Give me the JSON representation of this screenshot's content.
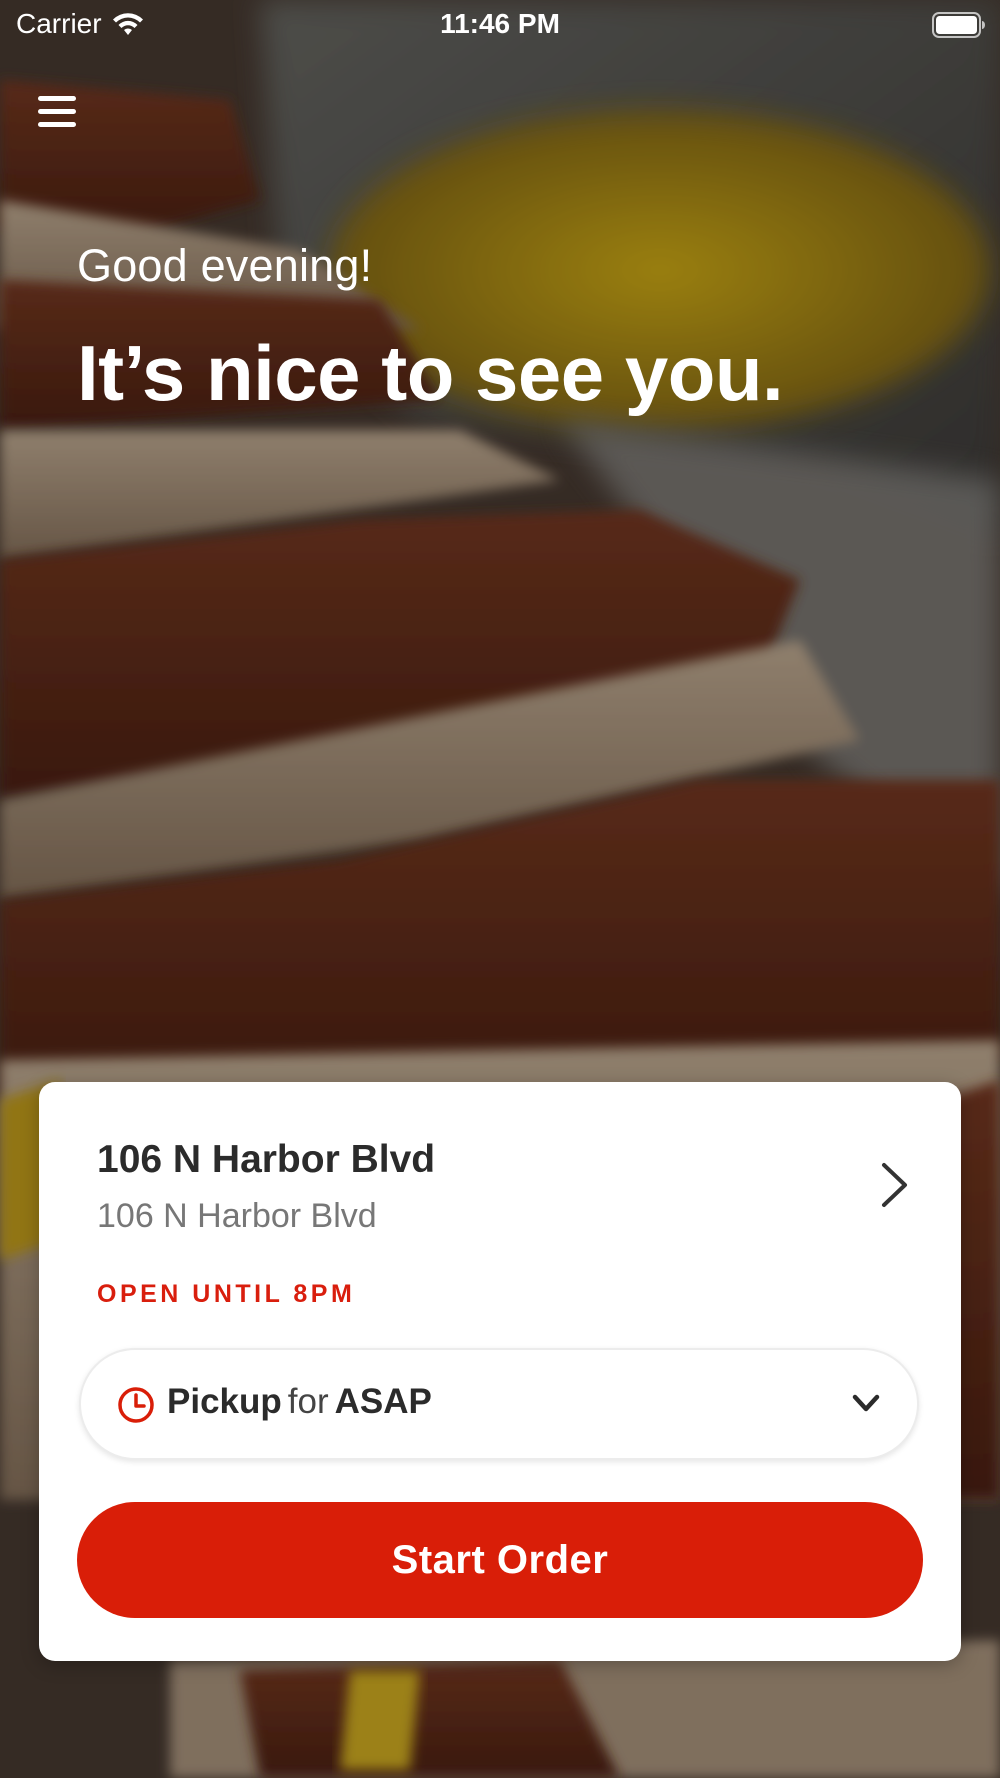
{
  "status_bar": {
    "carrier": "Carrier",
    "time": "11:46 PM",
    "wifi_icon": "wifi-icon",
    "battery_icon": "battery-icon"
  },
  "header": {
    "menu_icon": "hamburger-menu-icon"
  },
  "greeting": {
    "salutation": "Good evening!",
    "headline": "It’s nice to see you."
  },
  "location_card": {
    "name": "106 N Harbor Blvd",
    "address": "106 N Harbor Blvd",
    "hours_status": "OPEN UNTIL 8PM",
    "chevron_icon": "chevron-right-icon",
    "order_type": {
      "icon": "clock-icon",
      "mode": "Pickup",
      "connector": "for",
      "time": "ASAP",
      "dropdown_icon": "chevron-down-icon"
    },
    "start_button_label": "Start Order"
  },
  "colors": {
    "accent": "#d91e08",
    "status_text": "#d91e0d",
    "card_bg": "#ffffff",
    "title_text": "#2b2b2b",
    "subtitle_text": "#777777"
  },
  "background_image": "hot-dogs-with-chili-photo"
}
